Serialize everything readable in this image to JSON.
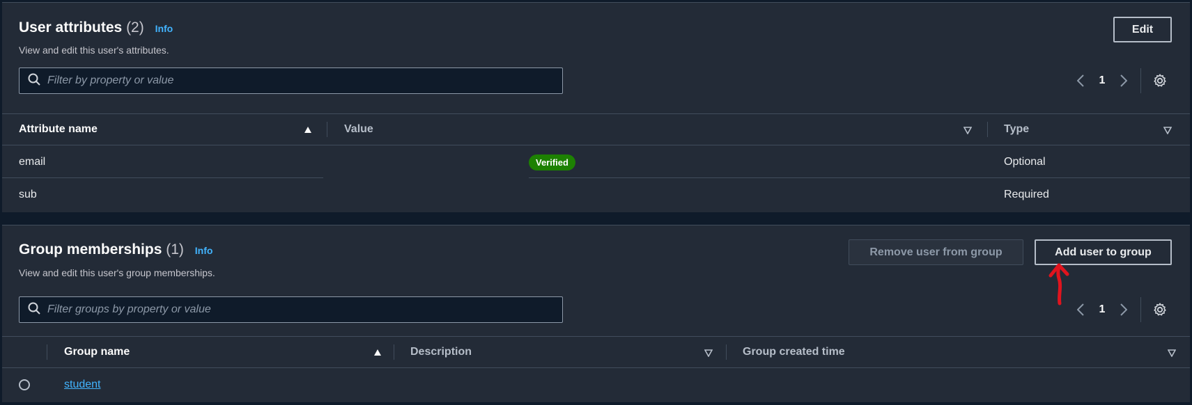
{
  "attributes": {
    "title": "User attributes",
    "count": "(2)",
    "info": "Info",
    "description": "View and edit this user's attributes.",
    "edit_label": "Edit",
    "filter_placeholder": "Filter by property or value",
    "page": "1",
    "columns": [
      "Attribute name",
      "Value",
      "Type"
    ],
    "rows": [
      {
        "name": "email",
        "value": "",
        "badge": "Verified",
        "type": "Optional"
      },
      {
        "name": "sub",
        "value": "",
        "badge": "",
        "type": "Required"
      }
    ]
  },
  "groups": {
    "title": "Group memberships",
    "count": "(1)",
    "info": "Info",
    "description": "View and edit this user's group memberships.",
    "remove_label": "Remove user from group",
    "add_label": "Add user to group",
    "filter_placeholder": "Filter groups by property or value",
    "page": "1",
    "columns": [
      "Group name",
      "Description",
      "Group created time"
    ],
    "rows": [
      {
        "name": "student",
        "description": "",
        "created": ""
      }
    ]
  },
  "colors": {
    "panel_bg": "#232b37",
    "page_bg": "#0f1b2a",
    "link": "#42b4ff",
    "verified_badge": "#1d8102",
    "annotation_arrow": "#e0141e"
  },
  "icons": [
    "search-icon",
    "chevron-left-icon",
    "chevron-right-icon",
    "gear-icon",
    "sort-ascending-icon",
    "sort-descending-icon",
    "annotation-arrow-icon"
  ]
}
